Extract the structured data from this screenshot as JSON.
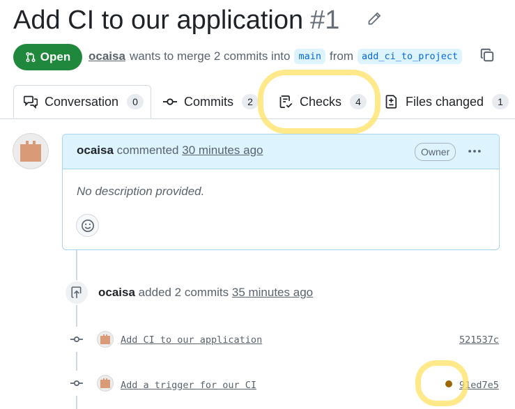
{
  "pr": {
    "title": "Add CI to our application",
    "number": "#1",
    "state": "Open",
    "author": "ocaisa",
    "meta_middle": "wants to merge 2 commits into",
    "base_branch": "main",
    "meta_from": "from",
    "head_branch": "add_ci_to_project"
  },
  "tabs": [
    {
      "label": "Conversation",
      "count": "0",
      "icon": "comment-discussion-icon"
    },
    {
      "label": "Commits",
      "count": "2",
      "icon": "git-commit-icon"
    },
    {
      "label": "Checks",
      "count": "4",
      "icon": "checklist-icon"
    },
    {
      "label": "Files changed",
      "count": "1",
      "icon": "file-diff-icon"
    }
  ],
  "comment": {
    "author": "ocaisa",
    "action": "commented",
    "time": "30 minutes ago",
    "badge": "Owner",
    "body": "No description provided."
  },
  "timeline": {
    "event_author": "ocaisa",
    "event_text": "added 2 commits",
    "event_time": "35 minutes ago",
    "commits": [
      {
        "message": "Add CI to our application",
        "sha": "521537c"
      },
      {
        "message": "Add a trigger for our CI",
        "sha": "91ed7e5",
        "status": "pending"
      }
    ]
  },
  "colors": {
    "open_green": "#1f883d",
    "branch_bg": "#ddf4ff",
    "branch_fg": "#0969da",
    "avatar": "#d99a78",
    "highlight": "#ffe264",
    "pending_dot": "#9a6700"
  }
}
